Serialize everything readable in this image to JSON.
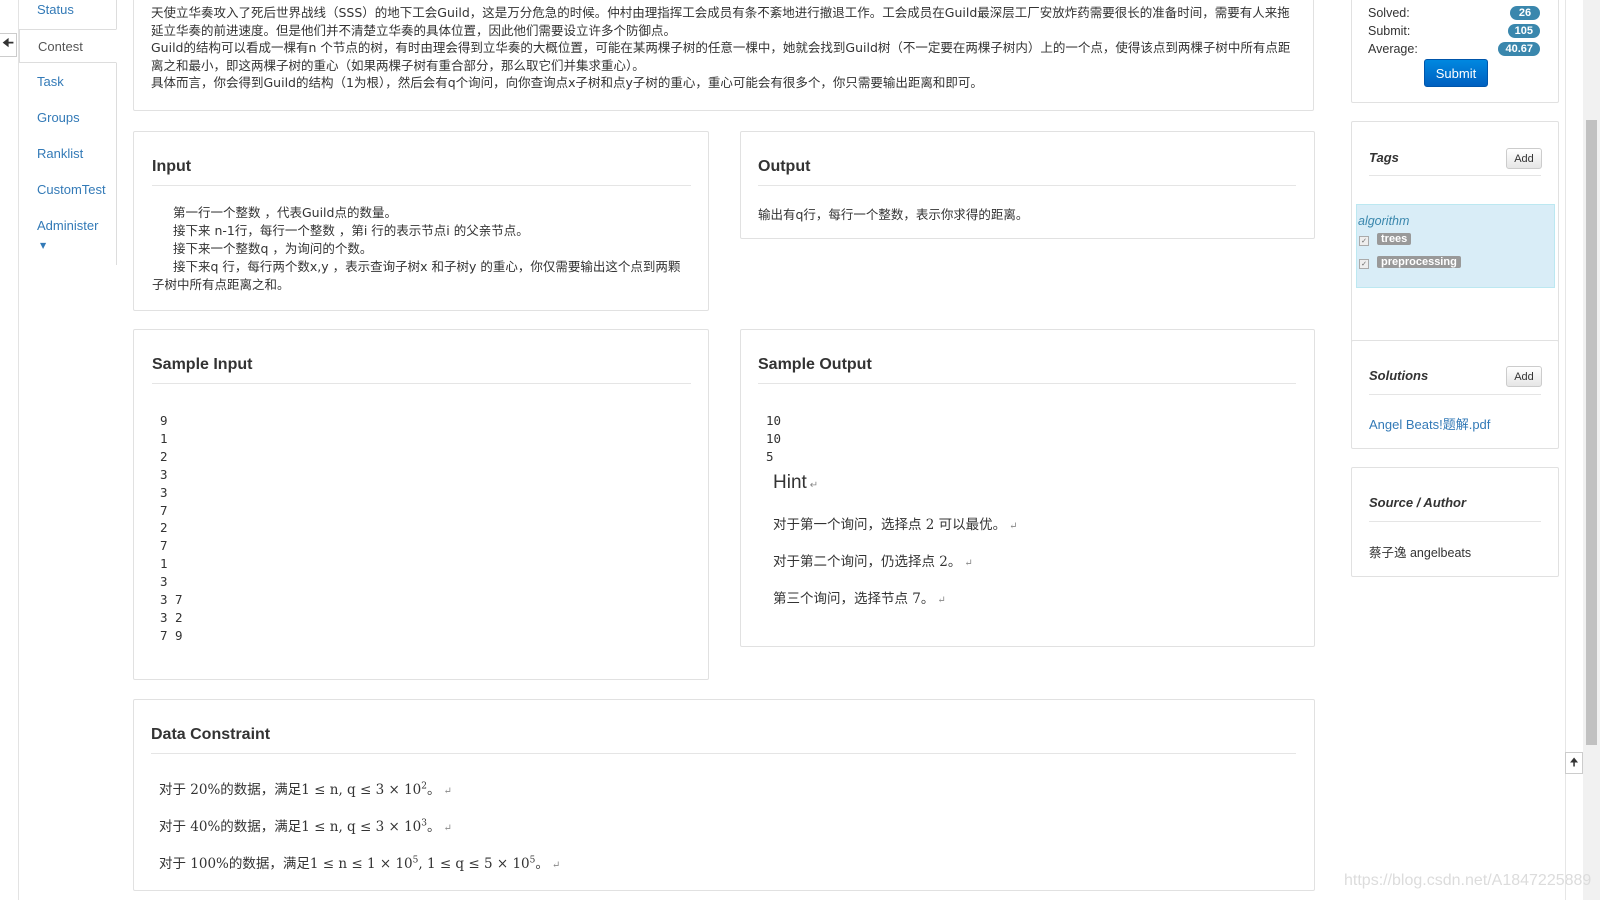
{
  "nav": {
    "items": [
      {
        "label": "Status",
        "active": false
      },
      {
        "label": "Contest",
        "active": true
      },
      {
        "label": "Task",
        "active": false
      },
      {
        "label": "Groups",
        "active": false
      },
      {
        "label": "Ranklist",
        "active": false
      },
      {
        "label": "CustomTest",
        "active": false
      },
      {
        "label": "Administer",
        "active": false
      }
    ]
  },
  "description": {
    "paragraphs": [
      "天使立华奏攻入了死后世界战线（SSS）的地下工会Guild，这是万分危急的时候。仲村由理指挥工会成员有条不紊地进行撤退工作。工会成员在Guild最深层工厂安放炸药需要很长的准备时间，需要有人来拖延立华奏的前进速度。但是他们并不清楚立华奏的具体位置，因此他们需要设立许多个防御点。",
      "Guild的结构可以看成一棵有n 个节点的树，有时由理会得到立华奏的大概位置，可能在某两棵子树的任意一棵中，她就会找到Guild树（不一定要在两棵子树内）上的一个点，使得该点到两棵子树中所有点距离之和最小，即这两棵子树的重心（如果两棵子树有重合部分，那么取它们并集求重心）。",
      "具体而言，你会得到Guild的结构（1为根），然后会有q个询问，向你查询点x子树和点y子树的重心，重心可能会有很多个，你只需要输出距离和即可。"
    ]
  },
  "input": {
    "title": "Input",
    "lines": [
      "第一行一个整数 ，代表Guild点的数量。",
      "接下来 n-1行，每行一个整数 ，第i 行的表示节点i 的父亲节点。",
      "接下来一个整数q ，为询问的个数。",
      "接下来q 行，每行两个数x,y ，表示查询子树x 和子树y 的重心，你仅需要输出这个点到两颗子树中所有点距离之和。"
    ]
  },
  "output": {
    "title": "Output",
    "text": "输出有q行，每行一个整数，表示你求得的距离。"
  },
  "sample_input": {
    "title": "Sample Input",
    "lines": [
      "9",
      "1",
      "2",
      "3",
      "3",
      "7",
      "2",
      "7",
      "1",
      "3",
      "3 7",
      "3 2",
      "7 9"
    ]
  },
  "sample_output": {
    "title": "Sample Output",
    "lines": [
      "10",
      "10",
      "5"
    ]
  },
  "hint": {
    "title": "Hint",
    "lines": [
      "对于第一个询问，选择点 2 可以最优。",
      "对于第二个询问，仍选择点 2。",
      "第三个询问，选择节点 7。"
    ]
  },
  "data_constraint": {
    "title": "Data Constraint",
    "lines": [
      {
        "prefix": "对于 20%的数据，满足",
        "math": "1 ≤ n, q ≤ 3 × 10",
        "exp": "2",
        "tail": "。"
      },
      {
        "prefix": "对于 40%的数据，满足",
        "math": "1 ≤ n, q ≤ 3 × 10",
        "exp": "3",
        "tail": "。"
      },
      {
        "prefix": "对于 100%的数据，满足",
        "math": "1 ≤ n ≤ 1 × 10",
        "exp": "5",
        "mid": ", 1 ≤ q ≤ 5 × 10",
        "exp2": "5",
        "tail": "。"
      }
    ]
  },
  "stats": {
    "solved_label": "Solved:",
    "solved": "26",
    "submit_label": "Submit:",
    "submit": "105",
    "average_label": "Average:",
    "average": "40.67",
    "submit_button": "Submit"
  },
  "tags": {
    "title": "Tags",
    "add_label": "Add",
    "category": "algorithm",
    "items": [
      "trees",
      "preprocessing"
    ]
  },
  "solutions": {
    "title": "Solutions",
    "add_label": "Add",
    "file": "Angel Beats!题解.pdf"
  },
  "source": {
    "title": "Source / Author",
    "author": "蔡子逸 angelbeats"
  },
  "watermark": "https://blog.csdn.net/A1847225889",
  "colors": {
    "link": "#337ab7",
    "badge": "#3a87ad",
    "primary": "#0074cc"
  }
}
